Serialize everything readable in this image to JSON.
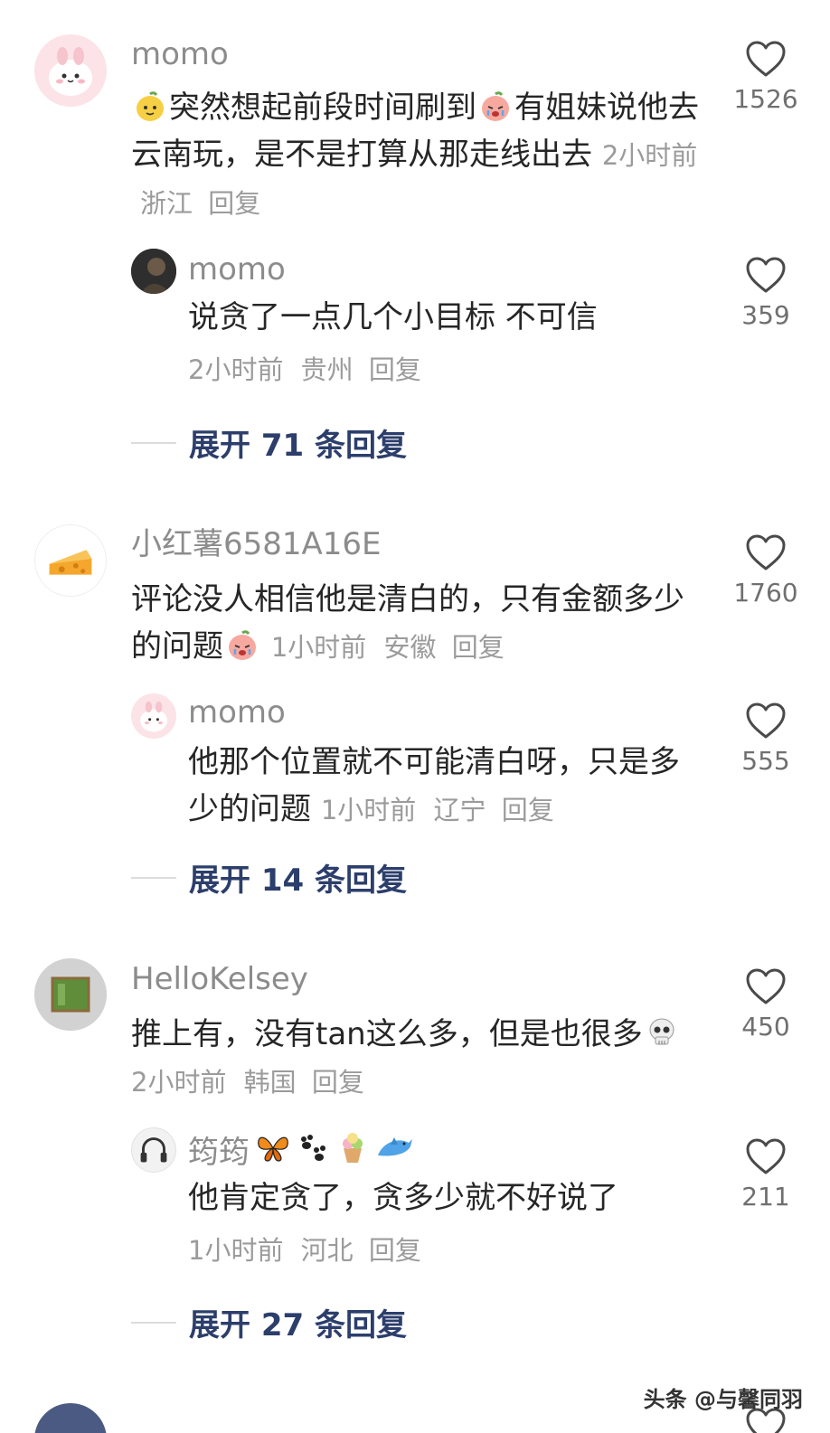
{
  "comments": [
    {
      "username": "momo",
      "text_a": "突然想起前段时间刷到",
      "text_b": "有姐妹说他去云南玩，是不是打算从那走线出去",
      "time": "2小时前",
      "location": "浙江",
      "reply": "回复",
      "likes": "1526",
      "avatar_icon": "pink-bunny-avatar",
      "sub": {
        "username": "momo",
        "text": "说贪了一点几个小目标 不可信",
        "time": "2小时前",
        "location": "贵州",
        "reply": "回复",
        "likes": "359",
        "avatar_icon": "dark-photo-avatar"
      },
      "expand": "展开 71 条回复"
    },
    {
      "username": "小红薯6581A16E",
      "text": "评论没人相信他是清白的，只有金额多少的问题",
      "time": "1小时前",
      "location": "安徽",
      "reply": "回复",
      "likes": "1760",
      "avatar_icon": "cheese-avatar",
      "sub": {
        "username": "momo",
        "text": "他那个位置就不可能清白呀，只是多少的问题",
        "time": "1小时前",
        "location": "辽宁",
        "reply": "回复",
        "likes": "555",
        "avatar_icon": "pink-bunny-avatar"
      },
      "expand": "展开 14 条回复"
    },
    {
      "username": "HelloKelsey",
      "text": "推上有，没有tan这么多，但是也很多",
      "time": "2小时前",
      "location": "韩国",
      "reply": "回复",
      "likes": "450",
      "avatar_icon": "green-frame-avatar",
      "sub": {
        "username": "筠筠",
        "text": "他肯定贪了，贪多少就不好说了",
        "time": "1小时前",
        "location": "河北",
        "reply": "回复",
        "likes": "211",
        "avatar_icon": "headphones-avatar"
      },
      "expand": "展开 27 条回复"
    }
  ],
  "watermark": "头条 @与馨同羽",
  "colors": {
    "like_icon": "#4a4a4a",
    "expand_text": "#2c3e6b",
    "meta_text": "#9b9b9b"
  }
}
